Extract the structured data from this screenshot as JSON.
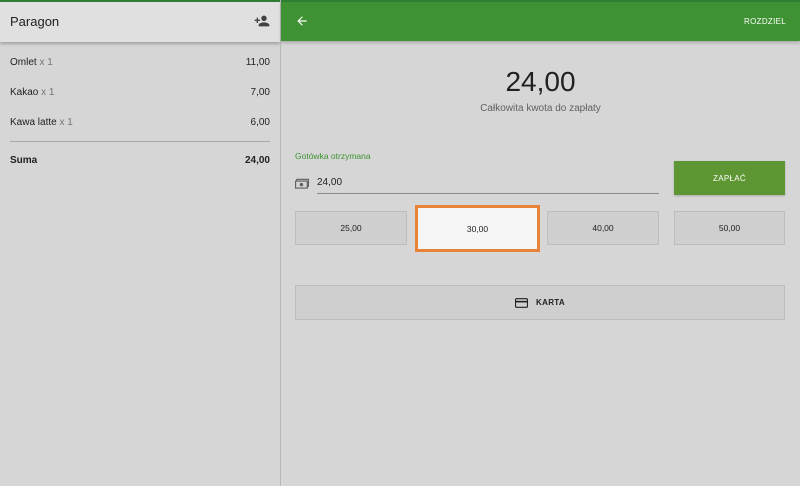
{
  "receipt": {
    "title": "Paragon",
    "add_customer_icon": "person-add-icon",
    "items": [
      {
        "name": "Omlet",
        "qty": "x 1",
        "price": "11,00"
      },
      {
        "name": "Kakao",
        "qty": "x 1",
        "price": "7,00"
      },
      {
        "name": "Kawa latte",
        "qty": "x 1",
        "price": "6,00"
      }
    ],
    "sum_label": "Suma",
    "sum_value": "24,00"
  },
  "payment": {
    "back_icon": "arrow-back-icon",
    "split_label": "ROZDZIEL",
    "total_amount": "24,00",
    "total_caption": "Całkowita kwota do zapłaty",
    "cash_label": "Gotówka otrzymana",
    "cash_icon": "cash-icon",
    "cash_value": "24,00",
    "pay_label": "ZAPŁAĆ",
    "quick_amounts": [
      "25,00",
      "30,00",
      "40,00",
      "50,00"
    ],
    "card_icon": "credit-card-icon",
    "card_label": "KARTA"
  },
  "colors": {
    "accent": "#3f9233",
    "pay_button": "#5e9634",
    "highlight": "#e8833a",
    "background": "#d6d6d6"
  }
}
